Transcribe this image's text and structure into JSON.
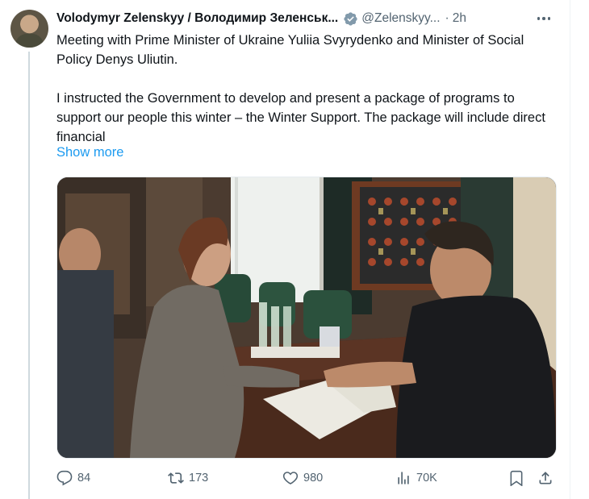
{
  "author": {
    "name": "Volodymyr Zelenskyy / Володимир Зеленськ...",
    "handle": "@Zelenskyy...",
    "separator": "·",
    "time": "2h"
  },
  "tweet": {
    "paragraph1": "Meeting with Prime Minister of Ukraine Yuliia Svyrydenko and Minister of Social Policy Denys Uliutin.",
    "paragraph2": "I instructed the Government to develop and present a package of programs to support our people this winter – the Winter Support. The package will include direct financial",
    "show_more": "Show more"
  },
  "metrics": {
    "replies": "84",
    "reposts": "173",
    "likes": "980",
    "views": "70K"
  },
  "colors": {
    "link": "#1d9bf0",
    "secondary_text": "#536471",
    "verified_badge": "#829aab"
  },
  "icons": {
    "verified": "verified-badge-icon",
    "more": "more-icon",
    "reply": "reply-icon",
    "repost": "repost-icon",
    "like": "like-icon",
    "views": "views-icon",
    "bookmark": "bookmark-icon",
    "share": "share-icon"
  }
}
